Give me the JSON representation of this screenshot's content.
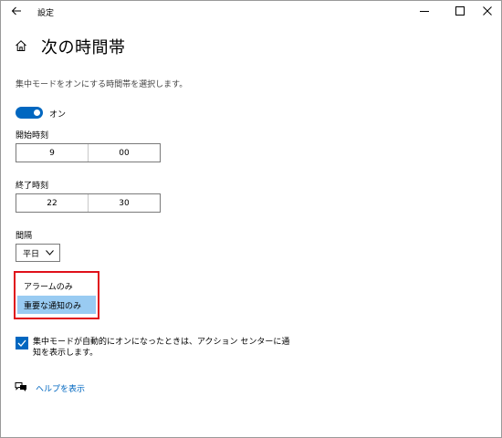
{
  "window": {
    "title": "設定",
    "icons": [
      "back-arrow-icon",
      "minimize-icon",
      "maximize-icon",
      "close-icon"
    ]
  },
  "page": {
    "title": "次の時間帯",
    "home_icon": "home-icon",
    "description": "集中モードをオンにする時間帯を選択します。"
  },
  "toggle": {
    "label": "オン",
    "state": "on",
    "accent": "#0067c0"
  },
  "start_time": {
    "label": "開始時刻",
    "hour": "9",
    "minute": "00"
  },
  "end_time": {
    "label": "終了時刻",
    "hour": "22",
    "minute": "30"
  },
  "repeat": {
    "label": "間隔",
    "selected": "平日"
  },
  "focus_dropdown": {
    "options": [
      "アラームのみ",
      "重要な通知のみ"
    ],
    "highlighted": "重要な通知のみ",
    "highlight_color": "#99cbf2",
    "outline_color": "#e0101a"
  },
  "checkbox": {
    "checked": true,
    "text": "集中モードが自動的にオンになったときは、アクション センターに通知を表示します。"
  },
  "help": {
    "icon": "help-chat-icon",
    "label": "ヘルプを表示"
  }
}
